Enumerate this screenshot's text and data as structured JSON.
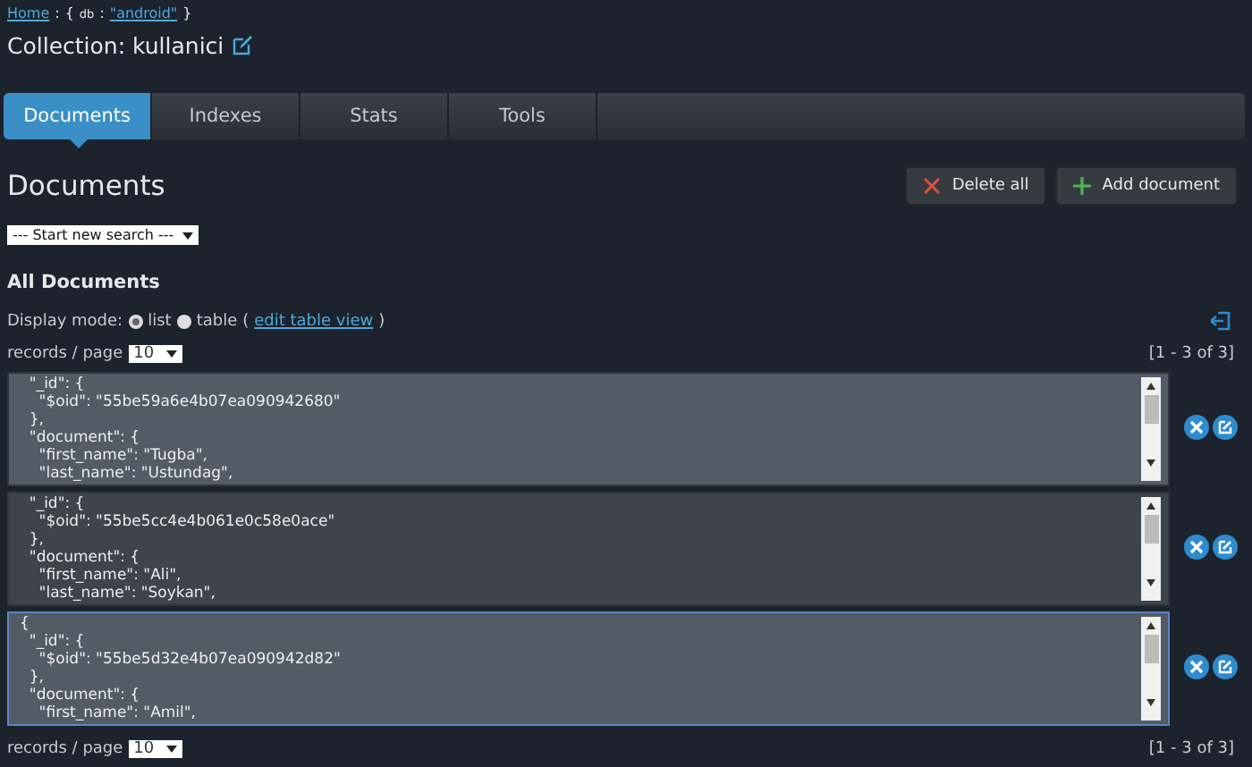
{
  "breadcrumb": {
    "home": "Home",
    "separator": ":",
    "db_open": "{",
    "db_label": "db",
    "db_colon": ":",
    "db_name": "\"android\"",
    "db_close": "}"
  },
  "title": "Collection: kullanici",
  "tabs": [
    {
      "label": "Documents",
      "selected": true
    },
    {
      "label": "Indexes",
      "selected": false
    },
    {
      "label": "Stats",
      "selected": false
    },
    {
      "label": "Tools",
      "selected": false
    }
  ],
  "heading": "Documents",
  "buttons": [
    {
      "kind": "delete",
      "label": "Delete all"
    },
    {
      "kind": "add",
      "label": "Add document"
    }
  ],
  "search_select": "--- Start new search ---",
  "section_title": "All Documents",
  "display_mode": {
    "label": "Display mode:",
    "options": [
      {
        "label": "list",
        "selected": true
      },
      {
        "label": "table",
        "selected": false
      }
    ],
    "link_open": "(",
    "link": "edit table view",
    "link_close": ")"
  },
  "pager_top": {
    "label": "records / page",
    "value": "10",
    "range": "[1 - 3 of 3]"
  },
  "records": [
    {
      "selected": false,
      "lines": [
        "  \"_id\": {",
        "    \"$oid\": \"55be59a6e4b07ea090942680\"",
        "  },",
        "  \"document\": {",
        "    \"first_name\": \"Tugba\",",
        "    \"last_name\": \"Ustundag\","
      ]
    },
    {
      "selected": false,
      "lines": [
        "  \"_id\": {",
        "    \"$oid\": \"55be5cc4e4b061e0c58e0ace\"",
        "  },",
        "  \"document\": {",
        "    \"first_name\": \"Ali\",",
        "    \"last_name\": \"Soykan\","
      ]
    },
    {
      "selected": true,
      "lines": [
        "{",
        "  \"_id\": {",
        "    \"$oid\": \"55be5d32e4b07ea090942d82\"",
        "  },",
        "  \"document\": {",
        "    \"first_name\": \"Amil\","
      ]
    }
  ],
  "pager_bottom": {
    "label": "records / page",
    "value": "10",
    "range": "[1 - 3 of 3]"
  }
}
